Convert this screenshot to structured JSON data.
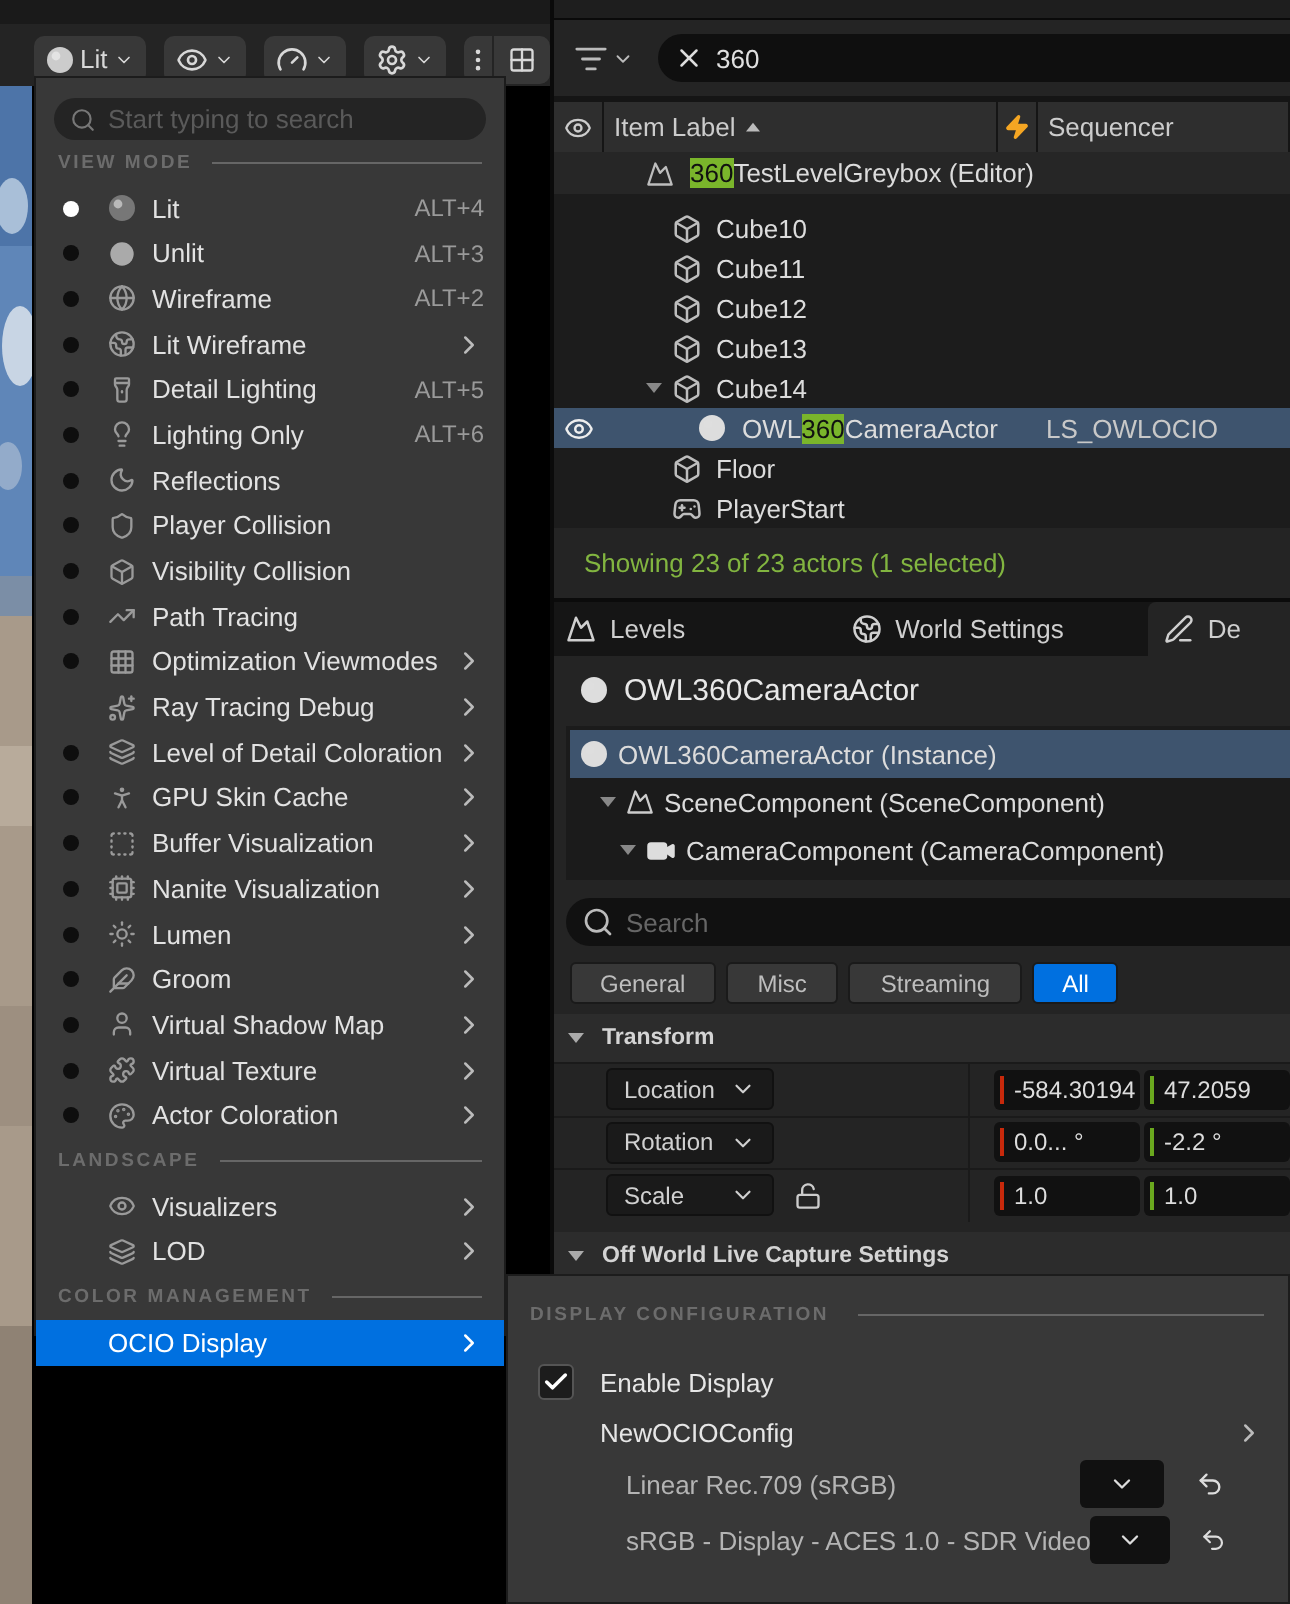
{
  "viewport_toolbar": {
    "view_mode_button": {
      "label": "Lit"
    }
  },
  "view_mode_menu": {
    "search": {
      "placeholder": "Start typing to search"
    },
    "sections": [
      {
        "title": "VIEW MODE",
        "items": [
          {
            "label": "Lit",
            "kind": "radio",
            "selected": true,
            "shortcut": "ALT+4",
            "submenu": false,
            "highlighted": false
          },
          {
            "label": "Unlit",
            "kind": "radio",
            "selected": false,
            "shortcut": "ALT+3",
            "submenu": false,
            "highlighted": false
          },
          {
            "label": "Wireframe",
            "kind": "radio",
            "selected": false,
            "shortcut": "ALT+2",
            "submenu": false,
            "highlighted": false
          },
          {
            "label": "Lit Wireframe",
            "kind": "radio",
            "selected": false,
            "submenu": true,
            "highlighted": false
          },
          {
            "label": "Detail Lighting",
            "kind": "radio",
            "selected": false,
            "shortcut": "ALT+5",
            "submenu": false,
            "highlighted": false
          },
          {
            "label": "Lighting Only",
            "kind": "radio",
            "selected": false,
            "shortcut": "ALT+6",
            "submenu": false,
            "highlighted": false
          },
          {
            "label": "Reflections",
            "kind": "radio",
            "selected": false,
            "submenu": false,
            "highlighted": false
          },
          {
            "label": "Player Collision",
            "kind": "radio",
            "selected": false,
            "submenu": false,
            "highlighted": false
          },
          {
            "label": "Visibility Collision",
            "kind": "radio",
            "selected": false,
            "submenu": false,
            "highlighted": false
          },
          {
            "label": "Path Tracing",
            "kind": "radio",
            "selected": false,
            "submenu": false,
            "highlighted": false
          },
          {
            "label": "Optimization Viewmodes",
            "kind": "radio",
            "selected": false,
            "submenu": true,
            "highlighted": false
          },
          {
            "label": "Ray Tracing Debug",
            "kind": "plain",
            "submenu": true,
            "highlighted": false
          },
          {
            "label": "Level of Detail Coloration",
            "kind": "radio",
            "selected": false,
            "submenu": true,
            "highlighted": false
          },
          {
            "label": "GPU Skin Cache",
            "kind": "radio",
            "selected": false,
            "submenu": true,
            "highlighted": false
          },
          {
            "label": "Buffer Visualization",
            "kind": "radio",
            "selected": false,
            "submenu": true,
            "highlighted": false
          },
          {
            "label": "Nanite Visualization",
            "kind": "radio",
            "selected": false,
            "submenu": true,
            "highlighted": false
          },
          {
            "label": "Lumen",
            "kind": "radio",
            "selected": false,
            "submenu": true,
            "highlighted": false
          },
          {
            "label": "Groom",
            "kind": "radio",
            "selected": false,
            "submenu": true,
            "highlighted": false
          },
          {
            "label": "Virtual Shadow Map",
            "kind": "radio",
            "selected": false,
            "submenu": true,
            "highlighted": false
          },
          {
            "label": "Virtual Texture",
            "kind": "radio",
            "selected": false,
            "submenu": true,
            "highlighted": false
          },
          {
            "label": "Actor Coloration",
            "kind": "radio",
            "selected": false,
            "submenu": true,
            "highlighted": false
          }
        ]
      },
      {
        "title": "LANDSCAPE",
        "items": [
          {
            "label": "Visualizers",
            "kind": "plain",
            "submenu": true,
            "highlighted": false
          },
          {
            "label": "LOD",
            "kind": "plain",
            "submenu": true,
            "highlighted": false
          }
        ]
      },
      {
        "title": "COLOR MANAGEMENT",
        "items": [
          {
            "label": "OCIO Display",
            "kind": "plain",
            "submenu": true,
            "highlighted": true
          }
        ]
      }
    ]
  },
  "ocio_submenu": {
    "section_title": "DISPLAY CONFIGURATION",
    "enable_display": {
      "label": "Enable Display",
      "checked": true
    },
    "config": {
      "label": "NewOCIOConfig"
    },
    "transforms": [
      {
        "label": "Linear Rec.709 (sRGB)"
      },
      {
        "label": "sRGB - Display - ACES 1.0 - SDR Video"
      }
    ]
  },
  "outliner": {
    "search": {
      "value": "360"
    },
    "columns": [
      "Item Label",
      "Sequencer"
    ],
    "rows": [
      {
        "kind": "level",
        "label": [
          {
            "text": "360",
            "match": true
          },
          {
            "text": "TestLevelGreybox (Editor)",
            "match": false
          }
        ],
        "selected": false,
        "children": [
          {
            "kind": "cube",
            "label": [
              {
                "text": "Cube10",
                "match": false
              }
            ],
            "selected": false
          },
          {
            "kind": "cube",
            "label": [
              {
                "text": "Cube11",
                "match": false
              }
            ],
            "selected": false
          },
          {
            "kind": "cube",
            "label": [
              {
                "text": "Cube12",
                "match": false
              }
            ],
            "selected": false
          },
          {
            "kind": "cube",
            "label": [
              {
                "text": "Cube13",
                "match": false
              }
            ],
            "selected": false
          },
          {
            "kind": "cube",
            "label": [
              {
                "text": "Cube14",
                "match": false
              }
            ],
            "selected": false,
            "expanded": true,
            "children": [
              {
                "kind": "camera",
                "label": [
                  {
                    "text": "OWL",
                    "match": false
                  },
                  {
                    "text": "360",
                    "match": true
                  },
                  {
                    "text": "CameraActor",
                    "match": false
                  }
                ],
                "selected": true,
                "sequencer": "LS_OWLOCIO"
              }
            ]
          },
          {
            "kind": "cube",
            "label": [
              {
                "text": "Floor",
                "match": false
              }
            ],
            "selected": false
          },
          {
            "kind": "player_start",
            "label": [
              {
                "text": "PlayerStart",
                "match": false
              }
            ],
            "selected": false
          }
        ]
      }
    ],
    "status": "Showing 23 of 23 actors (1 selected)"
  },
  "details": {
    "tabs": [
      {
        "label": "Levels",
        "selected": false
      },
      {
        "label": "World Settings",
        "selected": false
      },
      {
        "label": "De",
        "selected": true
      }
    ],
    "actor_name": "OWL360CameraActor",
    "components": [
      {
        "kind": "actor",
        "label": "OWL360CameraActor (Instance)",
        "selected": true,
        "children": [
          {
            "kind": "scene",
            "label": "SceneComponent (SceneComponent)",
            "selected": false,
            "expanded": true,
            "children": [
              {
                "kind": "camera",
                "label": "CameraComponent (CameraComponent)",
                "selected": false,
                "expanded": true
              }
            ]
          }
        ]
      }
    ],
    "search": {
      "placeholder": "Search"
    },
    "filters": [
      {
        "label": "General",
        "selected": false
      },
      {
        "label": "Misc",
        "selected": false
      },
      {
        "label": "Streaming",
        "selected": false
      },
      {
        "label": "All",
        "selected": true
      }
    ],
    "sections": [
      {
        "title": "Transform",
        "expanded": true,
        "rows": [
          {
            "label": "Location",
            "values": [
              {
                "color": "#c8290b",
                "text": "-584.30194"
              },
              {
                "color": "#6aa81e",
                "text": "47.2059"
              }
            ]
          },
          {
            "label": "Rotation",
            "values": [
              {
                "color": "#c8290b",
                "text": "0.0... °"
              },
              {
                "color": "#6aa81e",
                "text": "-2.2 °"
              }
            ]
          },
          {
            "label": "Scale",
            "locked": false,
            "values": [
              {
                "color": "#c8290b",
                "text": "1.0"
              },
              {
                "color": "#6aa81e",
                "text": "1.0"
              }
            ]
          }
        ]
      },
      {
        "title": "Off World Live Capture Settings",
        "expanded": true
      }
    ]
  }
}
